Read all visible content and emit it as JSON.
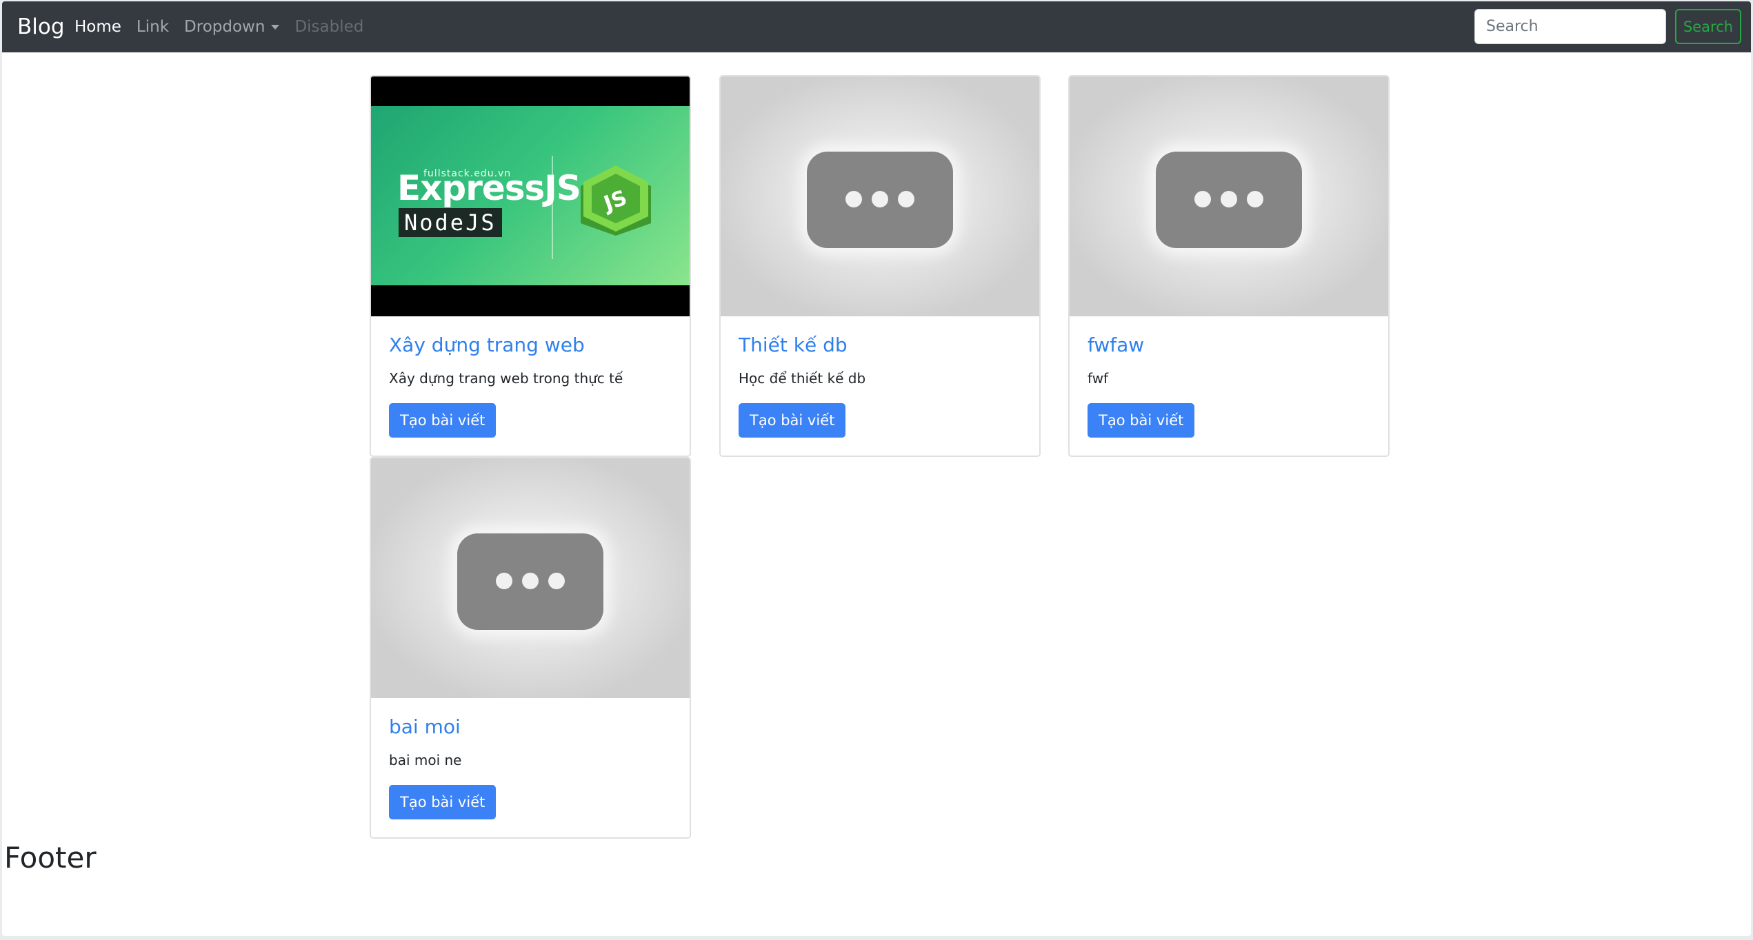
{
  "navbar": {
    "brand": "Blog",
    "links": [
      {
        "label": "Home",
        "state": "active"
      },
      {
        "label": "Link",
        "state": "normal"
      },
      {
        "label": "Dropdown",
        "state": "dropdown"
      },
      {
        "label": "Disabled",
        "state": "disabled"
      }
    ],
    "search_placeholder": "Search",
    "search_button": "Search"
  },
  "cards": [
    {
      "title": "Xây dựng trang web",
      "text": "Xây dựng trang web trong thực tế",
      "button": "Tạo bài viết",
      "thumbnail": "expressjs-nodejs-banner"
    },
    {
      "title": "Thiết kế db",
      "text": "Học để thiết kế db",
      "button": "Tạo bài viết",
      "thumbnail": "placeholder-icon"
    },
    {
      "title": "fwfaw",
      "text": "fwf",
      "button": "Tạo bài viết",
      "thumbnail": "placeholder-icon"
    },
    {
      "title": "bai moi",
      "text": "bai moi ne",
      "button": "Tạo bài viết",
      "thumbnail": "placeholder-icon"
    }
  ],
  "thumbnail_banner": {
    "site": "fullstack.edu.vn",
    "title": "ExpressJS",
    "subtitle": "NodeJS"
  },
  "footer": {
    "title": "Footer"
  },
  "colors": {
    "navbar_bg": "#343a40",
    "link_blue": "#2f80ed",
    "button_blue": "#3b82f6",
    "search_green": "#28a745"
  }
}
